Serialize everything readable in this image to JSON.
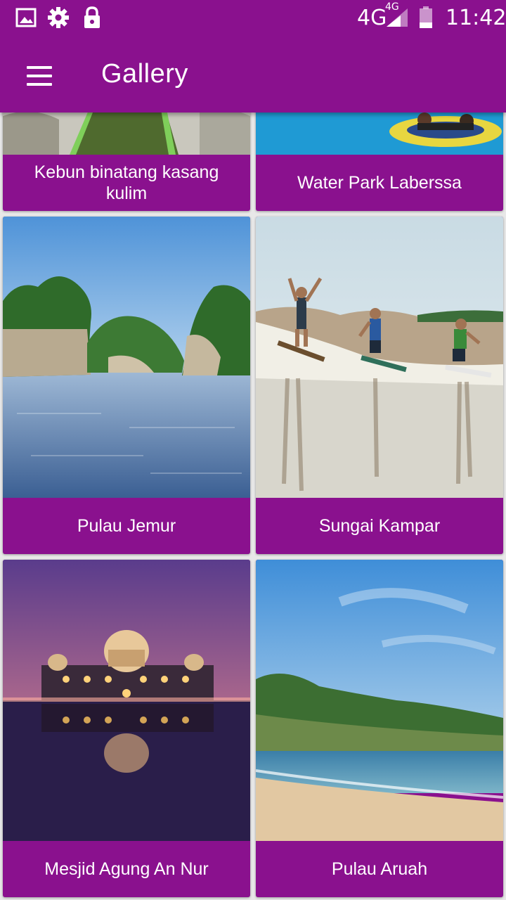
{
  "status_bar": {
    "network": "4G",
    "network_small": "4G",
    "time": "11:42",
    "left_icons": [
      "image-icon",
      "gear-icon",
      "lock-icon"
    ]
  },
  "toolbar": {
    "title": "Gallery",
    "menu_icon": "hamburger-menu-icon"
  },
  "gallery": {
    "items": [
      {
        "caption": "Kebun binatang kasang kulim"
      },
      {
        "caption": "Water Park Laberssa"
      },
      {
        "caption": "Pulau Jemur"
      },
      {
        "caption": "Sungai Kampar"
      },
      {
        "caption": "Mesjid Agung An Nur"
      },
      {
        "caption": "Pulau Aruah"
      }
    ]
  },
  "colors": {
    "primary": "#8a118e",
    "background": "#e8e8e8",
    "text": "#ffffff"
  }
}
